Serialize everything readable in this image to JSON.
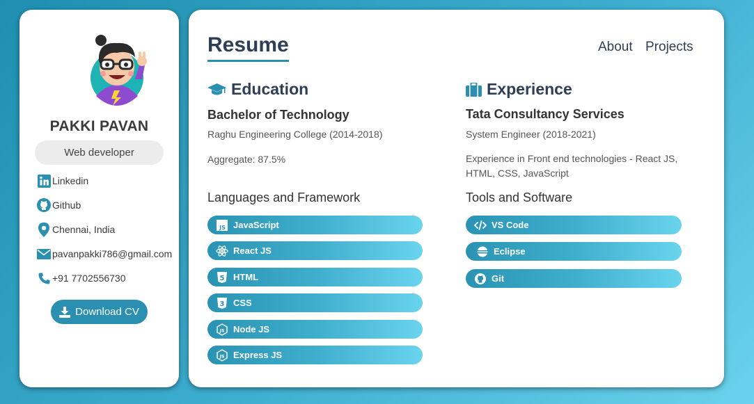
{
  "sidebar": {
    "name": "PAKKI PAVAN",
    "role": "Web developer",
    "contacts": [
      {
        "icon": "linkedin-icon",
        "label": "Linkedin"
      },
      {
        "icon": "github-icon",
        "label": "Github"
      },
      {
        "icon": "location-pin-icon",
        "label": "Chennai, India"
      },
      {
        "icon": "mail-icon",
        "label": "pavanpakki786@gmail.com"
      },
      {
        "icon": "phone-icon",
        "label": "+91 7702556730"
      }
    ],
    "download_label": "Download CV"
  },
  "main": {
    "title": "Resume",
    "nav": [
      "About",
      "Projects"
    ],
    "education": {
      "heading": "Education",
      "degree": "Bachelor of Technology",
      "college": "Raghu Engineering College (2014-2018)",
      "aggregate": "Aggregate: 87.5%"
    },
    "experience": {
      "heading": "Experience",
      "company": "Tata Consultancy Services",
      "position": "System Engineer (2018-2021)",
      "description": "Experience in Front end technologies - React JS, HTML, CSS, JavaScript"
    },
    "languages": {
      "heading": "Languages and Framework",
      "items": [
        "JavaScript",
        "React JS",
        "HTML",
        "CSS",
        "Node JS",
        "Express JS"
      ]
    },
    "tools": {
      "heading": "Tools and Software",
      "items": [
        "VS Code",
        "Eclipse",
        "Git"
      ]
    }
  },
  "colors": {
    "accent": "#2a8fb0",
    "title": "#2e3f55",
    "badge_bg": "#ececec"
  }
}
